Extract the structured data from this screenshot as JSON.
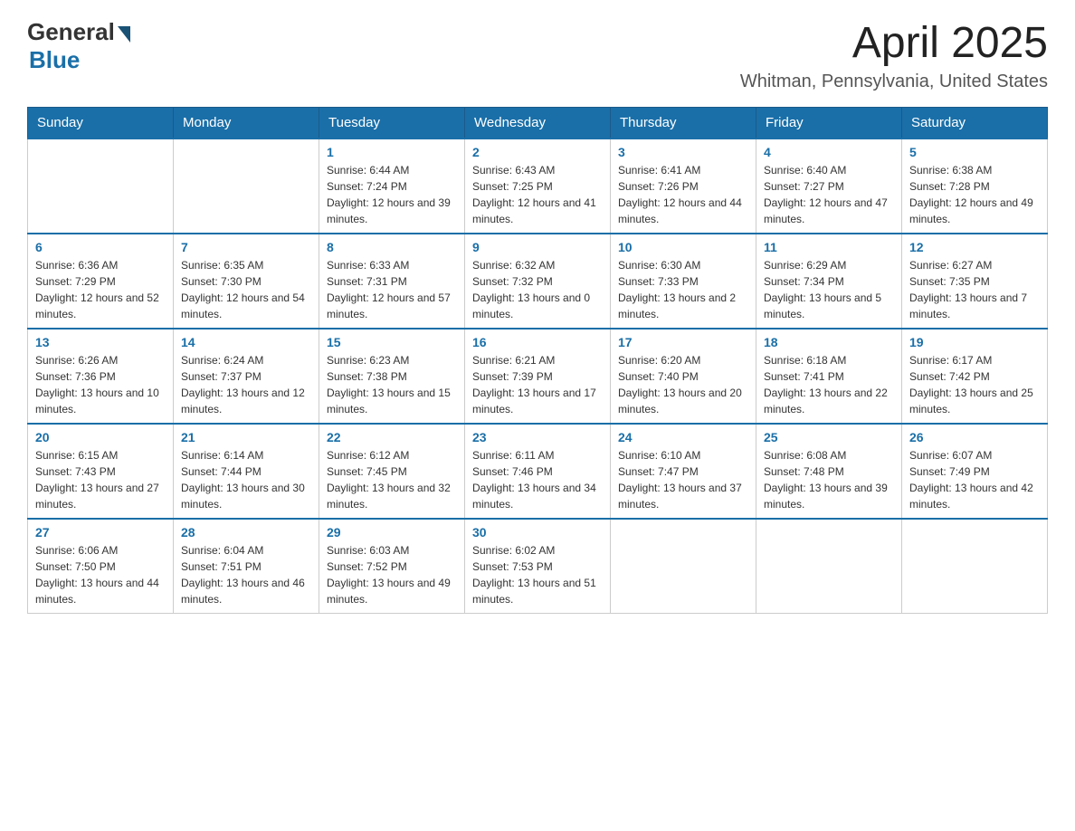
{
  "header": {
    "logo_general": "General",
    "logo_blue": "Blue",
    "title": "April 2025",
    "subtitle": "Whitman, Pennsylvania, United States"
  },
  "calendar": {
    "days_of_week": [
      "Sunday",
      "Monday",
      "Tuesday",
      "Wednesday",
      "Thursday",
      "Friday",
      "Saturday"
    ],
    "weeks": [
      [
        {
          "day": "",
          "sunrise": "",
          "sunset": "",
          "daylight": ""
        },
        {
          "day": "",
          "sunrise": "",
          "sunset": "",
          "daylight": ""
        },
        {
          "day": "1",
          "sunrise": "Sunrise: 6:44 AM",
          "sunset": "Sunset: 7:24 PM",
          "daylight": "Daylight: 12 hours and 39 minutes."
        },
        {
          "day": "2",
          "sunrise": "Sunrise: 6:43 AM",
          "sunset": "Sunset: 7:25 PM",
          "daylight": "Daylight: 12 hours and 41 minutes."
        },
        {
          "day": "3",
          "sunrise": "Sunrise: 6:41 AM",
          "sunset": "Sunset: 7:26 PM",
          "daylight": "Daylight: 12 hours and 44 minutes."
        },
        {
          "day": "4",
          "sunrise": "Sunrise: 6:40 AM",
          "sunset": "Sunset: 7:27 PM",
          "daylight": "Daylight: 12 hours and 47 minutes."
        },
        {
          "day": "5",
          "sunrise": "Sunrise: 6:38 AM",
          "sunset": "Sunset: 7:28 PM",
          "daylight": "Daylight: 12 hours and 49 minutes."
        }
      ],
      [
        {
          "day": "6",
          "sunrise": "Sunrise: 6:36 AM",
          "sunset": "Sunset: 7:29 PM",
          "daylight": "Daylight: 12 hours and 52 minutes."
        },
        {
          "day": "7",
          "sunrise": "Sunrise: 6:35 AM",
          "sunset": "Sunset: 7:30 PM",
          "daylight": "Daylight: 12 hours and 54 minutes."
        },
        {
          "day": "8",
          "sunrise": "Sunrise: 6:33 AM",
          "sunset": "Sunset: 7:31 PM",
          "daylight": "Daylight: 12 hours and 57 minutes."
        },
        {
          "day": "9",
          "sunrise": "Sunrise: 6:32 AM",
          "sunset": "Sunset: 7:32 PM",
          "daylight": "Daylight: 13 hours and 0 minutes."
        },
        {
          "day": "10",
          "sunrise": "Sunrise: 6:30 AM",
          "sunset": "Sunset: 7:33 PM",
          "daylight": "Daylight: 13 hours and 2 minutes."
        },
        {
          "day": "11",
          "sunrise": "Sunrise: 6:29 AM",
          "sunset": "Sunset: 7:34 PM",
          "daylight": "Daylight: 13 hours and 5 minutes."
        },
        {
          "day": "12",
          "sunrise": "Sunrise: 6:27 AM",
          "sunset": "Sunset: 7:35 PM",
          "daylight": "Daylight: 13 hours and 7 minutes."
        }
      ],
      [
        {
          "day": "13",
          "sunrise": "Sunrise: 6:26 AM",
          "sunset": "Sunset: 7:36 PM",
          "daylight": "Daylight: 13 hours and 10 minutes."
        },
        {
          "day": "14",
          "sunrise": "Sunrise: 6:24 AM",
          "sunset": "Sunset: 7:37 PM",
          "daylight": "Daylight: 13 hours and 12 minutes."
        },
        {
          "day": "15",
          "sunrise": "Sunrise: 6:23 AM",
          "sunset": "Sunset: 7:38 PM",
          "daylight": "Daylight: 13 hours and 15 minutes."
        },
        {
          "day": "16",
          "sunrise": "Sunrise: 6:21 AM",
          "sunset": "Sunset: 7:39 PM",
          "daylight": "Daylight: 13 hours and 17 minutes."
        },
        {
          "day": "17",
          "sunrise": "Sunrise: 6:20 AM",
          "sunset": "Sunset: 7:40 PM",
          "daylight": "Daylight: 13 hours and 20 minutes."
        },
        {
          "day": "18",
          "sunrise": "Sunrise: 6:18 AM",
          "sunset": "Sunset: 7:41 PM",
          "daylight": "Daylight: 13 hours and 22 minutes."
        },
        {
          "day": "19",
          "sunrise": "Sunrise: 6:17 AM",
          "sunset": "Sunset: 7:42 PM",
          "daylight": "Daylight: 13 hours and 25 minutes."
        }
      ],
      [
        {
          "day": "20",
          "sunrise": "Sunrise: 6:15 AM",
          "sunset": "Sunset: 7:43 PM",
          "daylight": "Daylight: 13 hours and 27 minutes."
        },
        {
          "day": "21",
          "sunrise": "Sunrise: 6:14 AM",
          "sunset": "Sunset: 7:44 PM",
          "daylight": "Daylight: 13 hours and 30 minutes."
        },
        {
          "day": "22",
          "sunrise": "Sunrise: 6:12 AM",
          "sunset": "Sunset: 7:45 PM",
          "daylight": "Daylight: 13 hours and 32 minutes."
        },
        {
          "day": "23",
          "sunrise": "Sunrise: 6:11 AM",
          "sunset": "Sunset: 7:46 PM",
          "daylight": "Daylight: 13 hours and 34 minutes."
        },
        {
          "day": "24",
          "sunrise": "Sunrise: 6:10 AM",
          "sunset": "Sunset: 7:47 PM",
          "daylight": "Daylight: 13 hours and 37 minutes."
        },
        {
          "day": "25",
          "sunrise": "Sunrise: 6:08 AM",
          "sunset": "Sunset: 7:48 PM",
          "daylight": "Daylight: 13 hours and 39 minutes."
        },
        {
          "day": "26",
          "sunrise": "Sunrise: 6:07 AM",
          "sunset": "Sunset: 7:49 PM",
          "daylight": "Daylight: 13 hours and 42 minutes."
        }
      ],
      [
        {
          "day": "27",
          "sunrise": "Sunrise: 6:06 AM",
          "sunset": "Sunset: 7:50 PM",
          "daylight": "Daylight: 13 hours and 44 minutes."
        },
        {
          "day": "28",
          "sunrise": "Sunrise: 6:04 AM",
          "sunset": "Sunset: 7:51 PM",
          "daylight": "Daylight: 13 hours and 46 minutes."
        },
        {
          "day": "29",
          "sunrise": "Sunrise: 6:03 AM",
          "sunset": "Sunset: 7:52 PM",
          "daylight": "Daylight: 13 hours and 49 minutes."
        },
        {
          "day": "30",
          "sunrise": "Sunrise: 6:02 AM",
          "sunset": "Sunset: 7:53 PM",
          "daylight": "Daylight: 13 hours and 51 minutes."
        },
        {
          "day": "",
          "sunrise": "",
          "sunset": "",
          "daylight": ""
        },
        {
          "day": "",
          "sunrise": "",
          "sunset": "",
          "daylight": ""
        },
        {
          "day": "",
          "sunrise": "",
          "sunset": "",
          "daylight": ""
        }
      ]
    ]
  }
}
